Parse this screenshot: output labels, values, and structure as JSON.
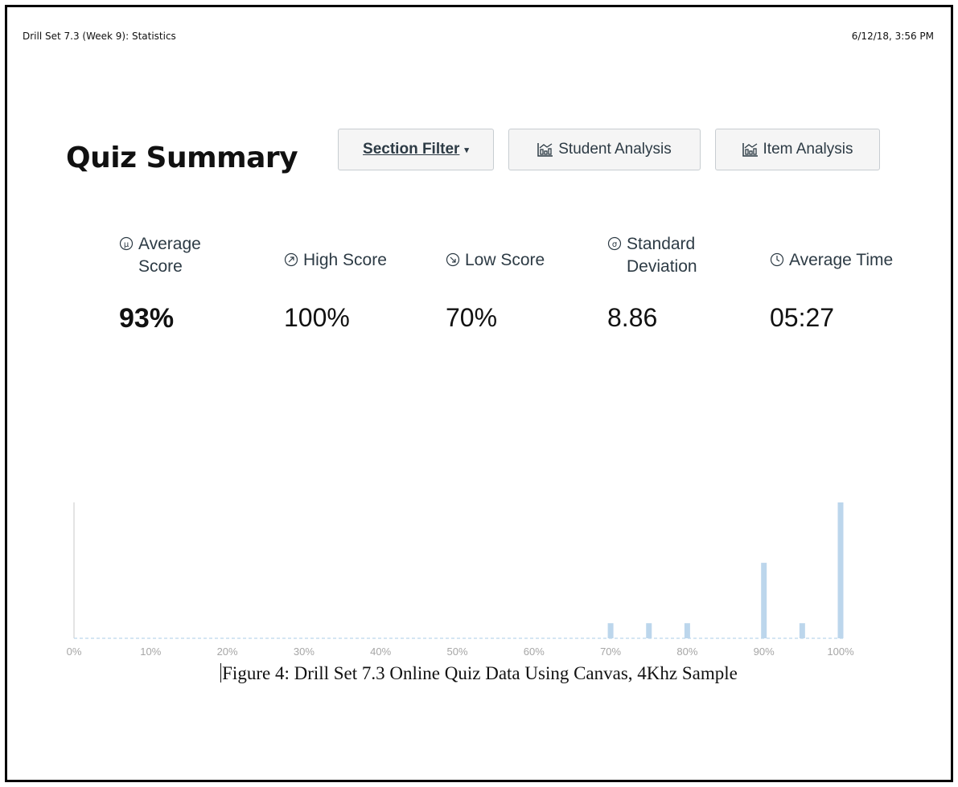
{
  "header": {
    "doc_title": "Drill Set 7.3 (Week 9): Statistics",
    "timestamp": "6/12/18, 3:56 PM"
  },
  "page_title": "Quiz Summary",
  "toolbar": {
    "section_filter_label": "Section Filter",
    "student_analysis_label": "Student Analysis",
    "item_analysis_label": "Item Analysis"
  },
  "stats": {
    "average_score": {
      "label": "Average Score",
      "value": "93%"
    },
    "high_score": {
      "label": "High Score",
      "value": "100%"
    },
    "low_score": {
      "label": "Low Score",
      "value": "70%"
    },
    "standard_deviation": {
      "label": "Standard Deviation",
      "value": "8.86"
    },
    "average_time": {
      "label": "Average Time",
      "value": "05:27"
    }
  },
  "chart_data": {
    "type": "bar",
    "x": [
      0,
      10,
      20,
      30,
      40,
      50,
      60,
      70,
      75,
      80,
      90,
      95,
      100
    ],
    "values": [
      0,
      0,
      0,
      0,
      0,
      0,
      0,
      1,
      1,
      1,
      5,
      1,
      9
    ],
    "tick_labels": [
      "0%",
      "10%",
      "20%",
      "30%",
      "40%",
      "50%",
      "60%",
      "70%",
      "80%",
      "90%",
      "100%"
    ],
    "xlim": [
      0,
      100
    ],
    "bar_color": "#bcd6ec",
    "grid": false
  },
  "caption": "Figure 4: Drill Set 7.3 Online Quiz Data Using Canvas, 4Khz Sample",
  "colors": {
    "bar": "#bcd6ec",
    "text": "#2d3b45",
    "axis_label": "#a6a6a6"
  }
}
